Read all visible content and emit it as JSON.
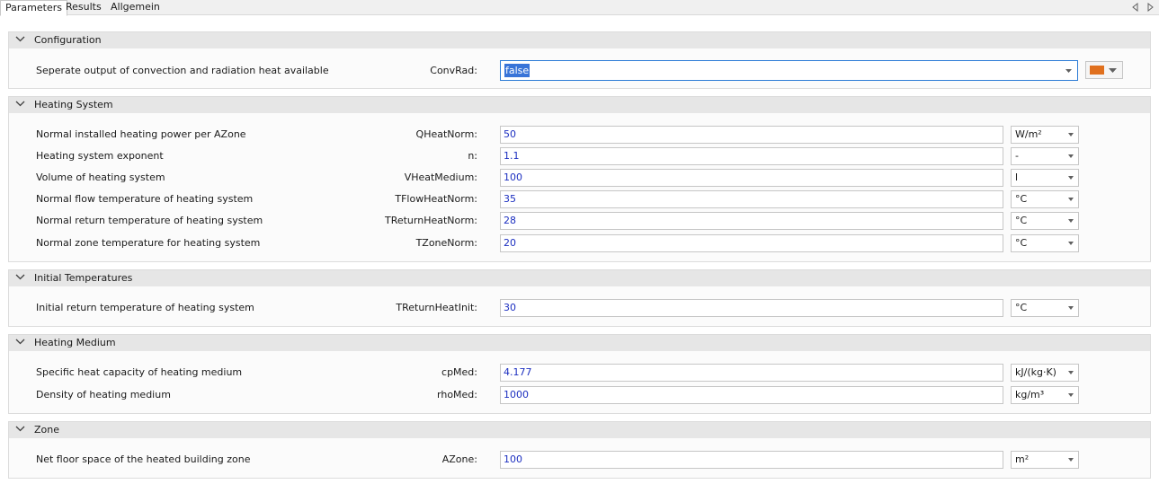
{
  "tabs": [
    {
      "label": "Parameters",
      "active": true
    },
    {
      "label": "Results",
      "active": false
    },
    {
      "label": "Allgemein",
      "active": false
    }
  ],
  "colors": {
    "value_text": "#1c2fc0",
    "header_bg": "#e6e6e6",
    "focus_border": "#2b7bd6",
    "selection_bg": "#3874d8",
    "onoff_icon": "#e0701e"
  },
  "icons": {
    "section_toggle": "chevron-down-icon",
    "dropdown": "triangle-down-icon",
    "onoff": "on-off-icon"
  },
  "sections": {
    "configuration": {
      "title": "Configuration",
      "rows": [
        {
          "desc": "Seperate output of convection and radiation heat available",
          "name": "ConvRad:",
          "value": "false"
        }
      ]
    },
    "heating_system": {
      "title": "Heating System",
      "rows": [
        {
          "desc": "Normal installed heating power per AZone",
          "name": "QHeatNorm:",
          "value": "50",
          "unit": "W/m²"
        },
        {
          "desc": "Heating system exponent",
          "name": "n:",
          "value": "1.1",
          "unit": "-"
        },
        {
          "desc": "Volume of heating system",
          "name": "VHeatMedium:",
          "value": "100",
          "unit": "l"
        },
        {
          "desc": "Normal flow temperature of heating system",
          "name": "TFlowHeatNorm:",
          "value": "35",
          "unit": "°C"
        },
        {
          "desc": "Normal return temperature of heating system",
          "name": "TReturnHeatNorm:",
          "value": "28",
          "unit": "°C"
        },
        {
          "desc": "Normal zone temperature for heating system",
          "name": "TZoneNorm:",
          "value": "20",
          "unit": "°C"
        }
      ]
    },
    "initial_temperatures": {
      "title": "Initial Temperatures",
      "rows": [
        {
          "desc": "Initial return temperature of heating system",
          "name": "TReturnHeatInit:",
          "value": "30",
          "unit": "°C"
        }
      ]
    },
    "heating_medium": {
      "title": "Heating Medium",
      "rows": [
        {
          "desc": "Specific heat capacity of heating medium",
          "name": "cpMed:",
          "value": "4.177",
          "unit": "kJ/(kg·K)"
        },
        {
          "desc": "Density of heating medium",
          "name": "rhoMed:",
          "value": "1000",
          "unit": "kg/m³"
        }
      ]
    },
    "zone": {
      "title": "Zone",
      "rows": [
        {
          "desc": "Net floor space of the heated building zone",
          "name": "AZone:",
          "value": "100",
          "unit": "m²"
        }
      ]
    }
  }
}
